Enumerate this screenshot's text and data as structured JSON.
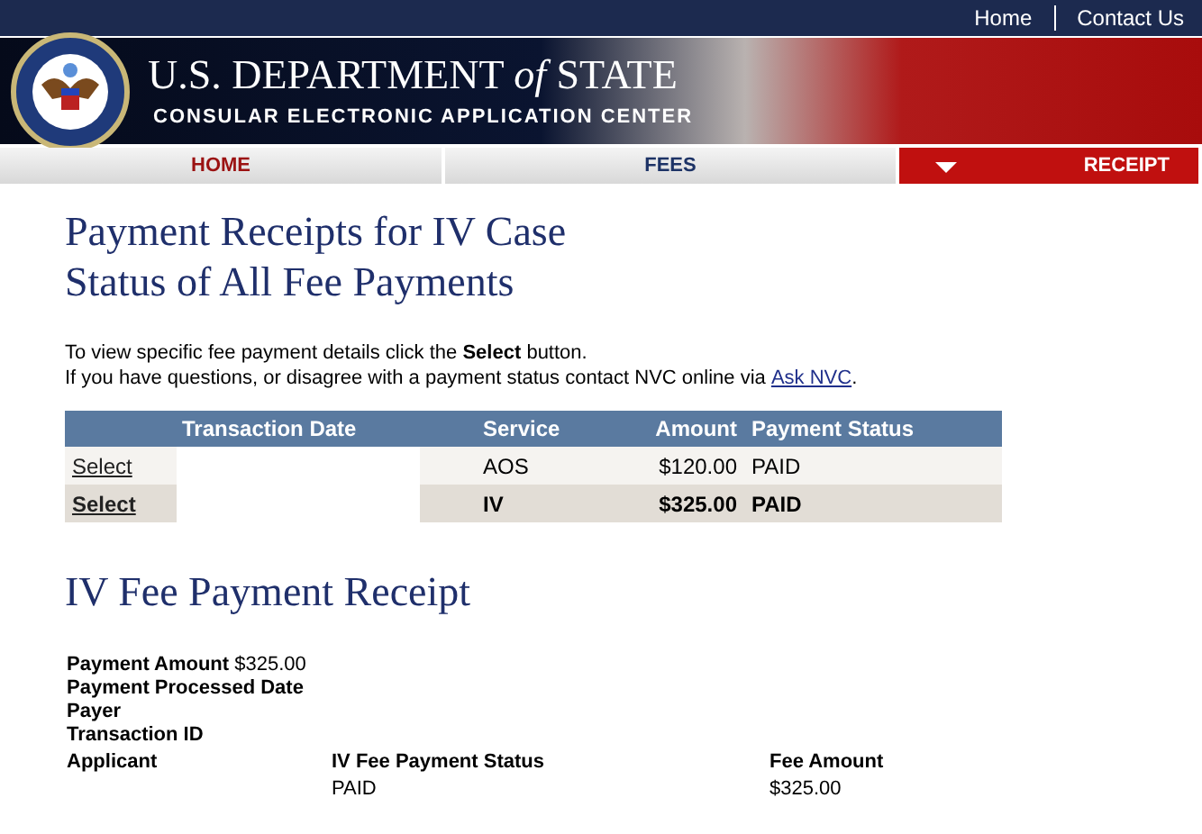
{
  "top_links": [
    "Home",
    "Contact Us"
  ],
  "banner": {
    "title": "U.S. DEPARTMENT *of* STATE",
    "subtitle": "CONSULAR ELECTRONIC APPLICATION CENTER"
  },
  "nav_tabs": [
    {
      "label": "HOME",
      "selected": false
    },
    {
      "label": "FEES",
      "selected": false
    },
    {
      "label": "RECEIPT",
      "selected": true
    }
  ],
  "page_title": [
    "Payment Receipts for IV Case",
    "Status of All Fee Payments"
  ],
  "instructions": [
    "To view specific fee payment details click the **Select** button.",
    "If you have questions, or disagree with a payment status contact NVC online via"
  ],
  "ask_link": "Ask NVC",
  "ask_suffix": ".",
  "table": {
    "columns": [
      "Transaction Date",
      "Service",
      "Amount",
      "Payment Status"
    ],
    "rows": [
      {
        "action": "Select",
        "service": "AOS",
        "amount": "$120.00",
        "status": "PAID",
        "selected": false
      },
      {
        "action": "Select",
        "service": "IV",
        "amount": "$325.00",
        "status": "PAID",
        "selected": true
      }
    ]
  },
  "receipt": {
    "title": "IV Fee Payment Receipt",
    "payment_amount_label": "Payment Amount",
    "payment_amount": "$325.00",
    "fields": [
      "Payment Processed Date",
      "Payer",
      "Transaction ID"
    ],
    "columns": [
      "Applicant",
      "IV Fee Payment Status",
      "Fee Amount"
    ],
    "status": "PAID",
    "fee_amount": "$325.00"
  }
}
